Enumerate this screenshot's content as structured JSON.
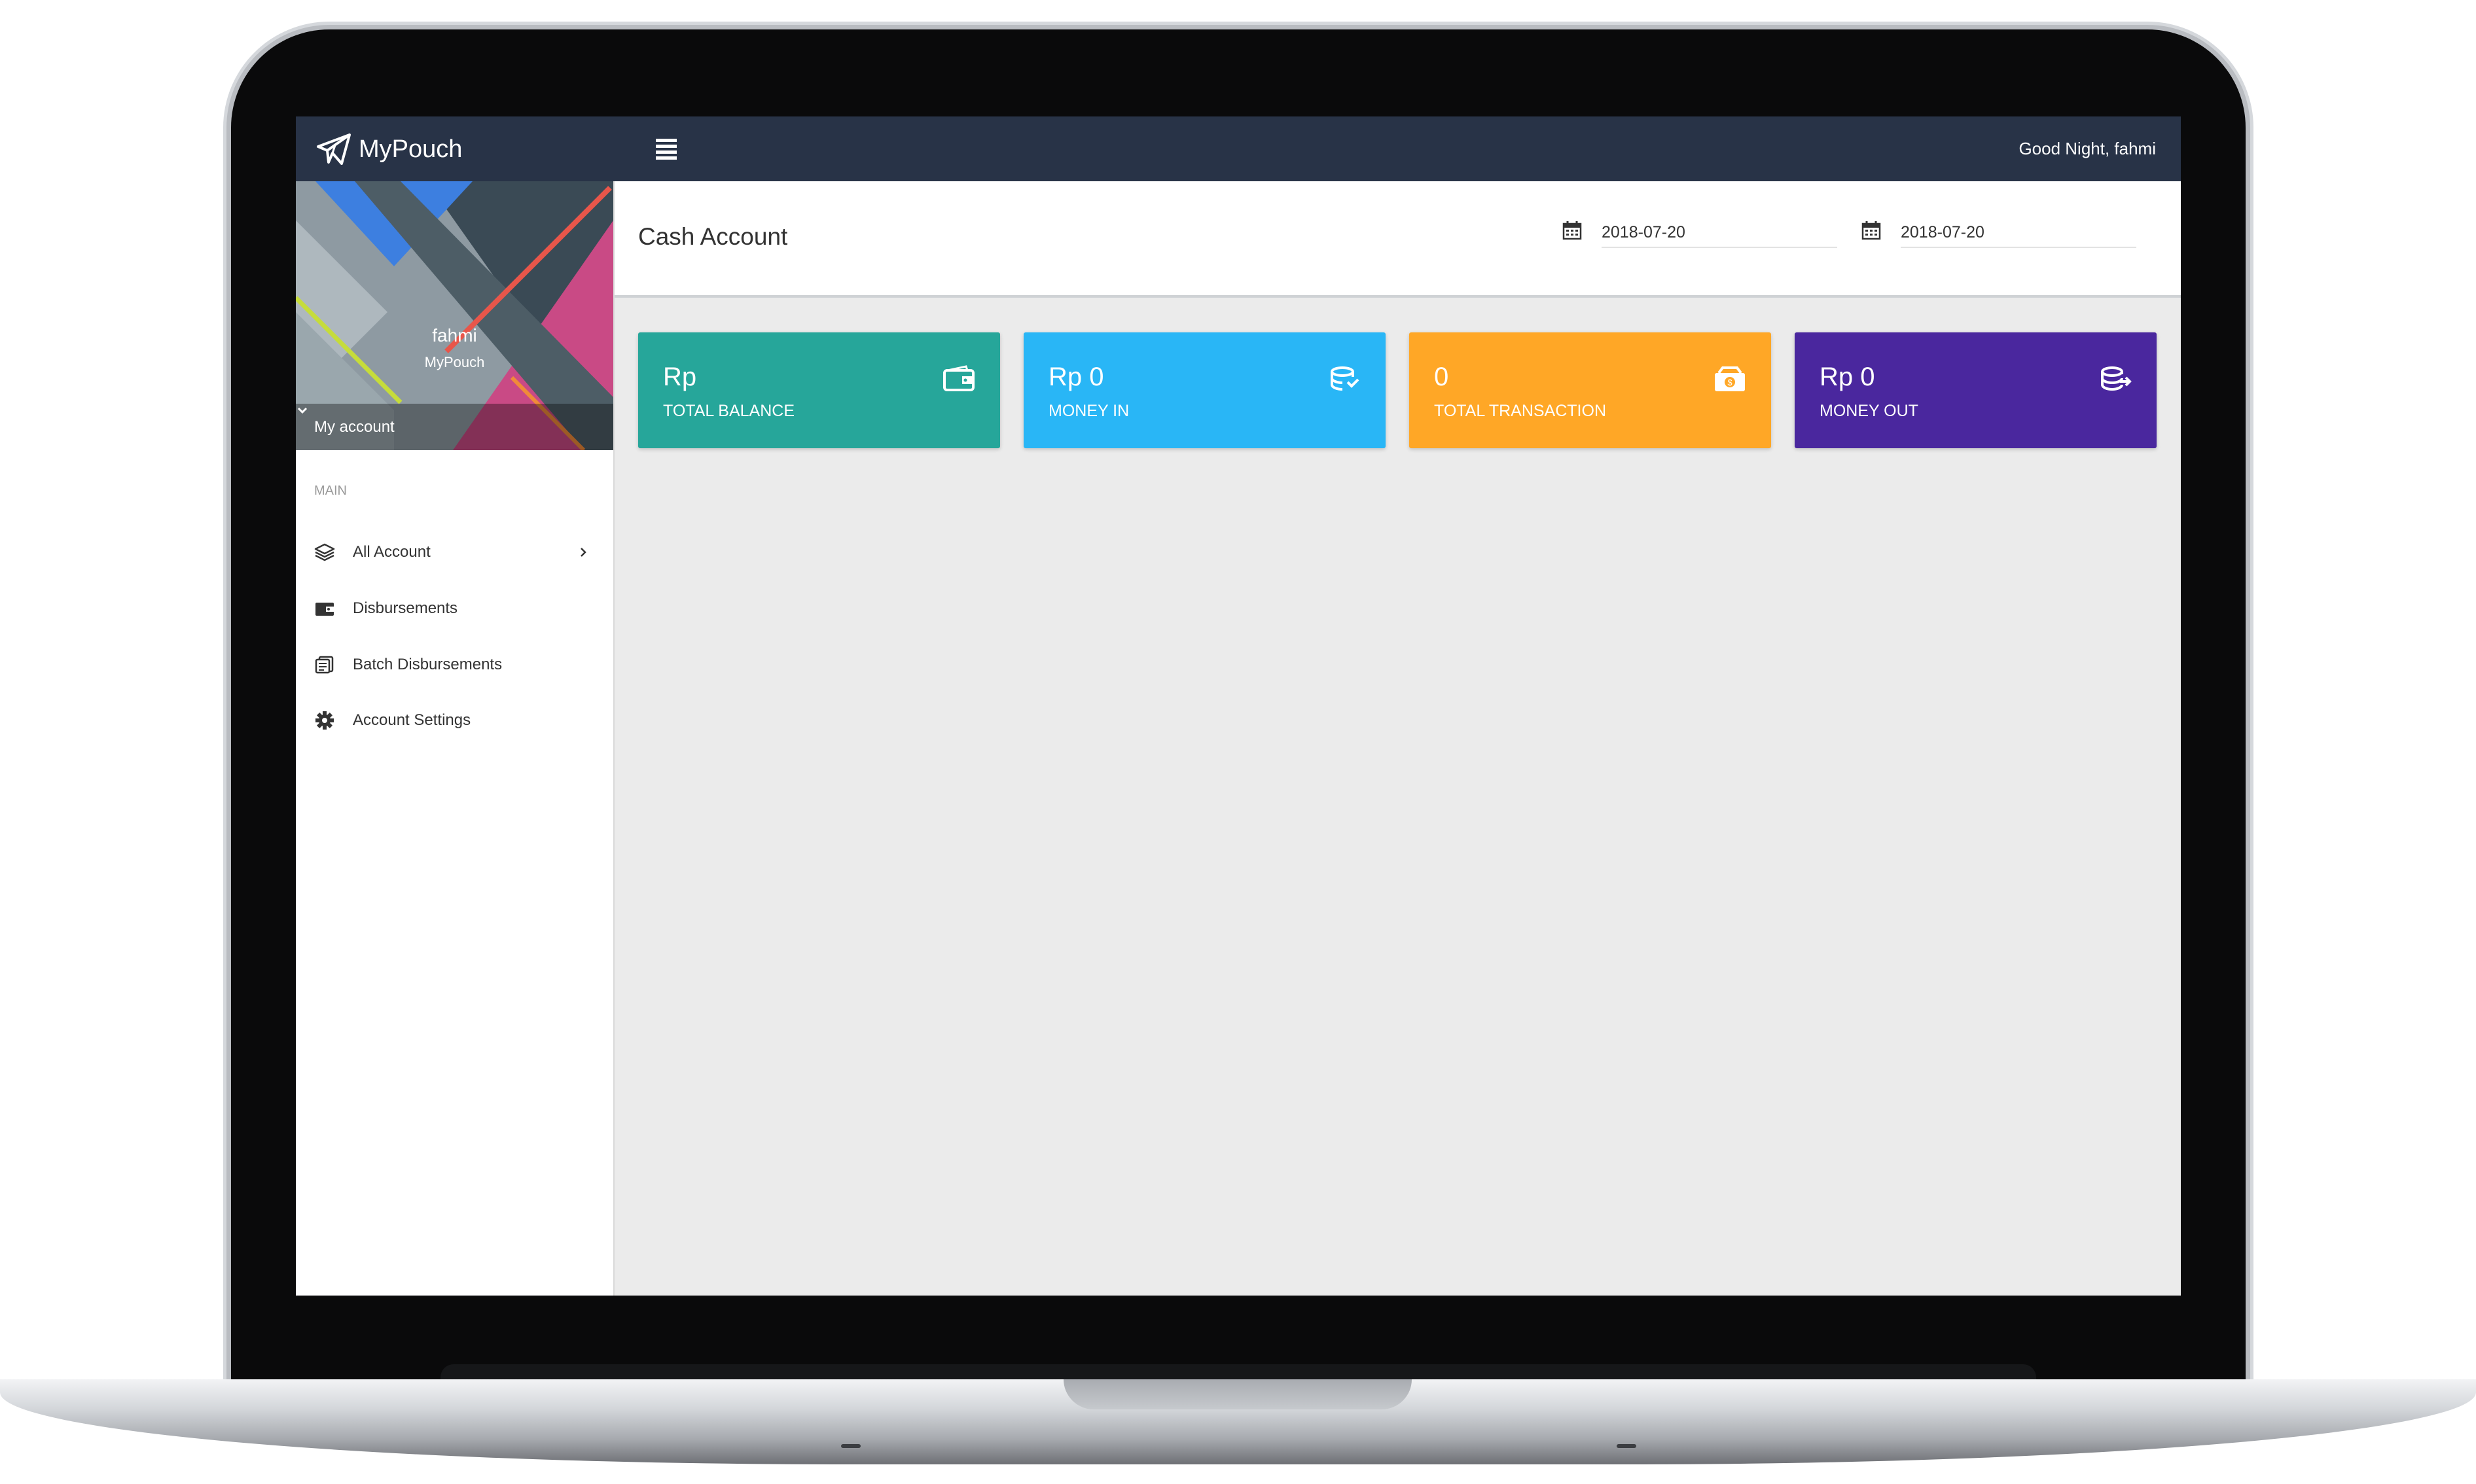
{
  "app": {
    "name": "MyPouch",
    "greeting": "Good Night, fahmi"
  },
  "profile": {
    "name": "fahmi",
    "organization": "MyPouch",
    "account_menu_label": "My account"
  },
  "sidebar": {
    "section_header": "MAIN",
    "items": [
      {
        "label": "All Account",
        "icon": "layers-icon",
        "has_submenu": true
      },
      {
        "label": "Disbursements",
        "icon": "wallet-icon",
        "has_submenu": false
      },
      {
        "label": "Batch Disbursements",
        "icon": "receipts-icon",
        "has_submenu": false
      },
      {
        "label": "Account Settings",
        "icon": "gear-icon",
        "has_submenu": false
      }
    ]
  },
  "page": {
    "title": "Cash Account",
    "date_from": "2018-07-20",
    "date_to": "2018-07-20"
  },
  "cards": [
    {
      "value": "Rp",
      "label": "TOTAL BALANCE",
      "icon": "wallet-icon",
      "color": "#26a69a"
    },
    {
      "value": "Rp 0",
      "label": "MONEY IN",
      "icon": "coins-in-icon",
      "color": "#29b6f6"
    },
    {
      "value": "0",
      "label": "TOTAL TRANSACTION",
      "icon": "cash-icon",
      "color": "#ffa726"
    },
    {
      "value": "Rp 0",
      "label": "MONEY OUT",
      "icon": "coins-out-icon",
      "color": "#4a279e"
    }
  ],
  "colors": {
    "topbar": "#283347",
    "content_background": "#ebebeb"
  }
}
